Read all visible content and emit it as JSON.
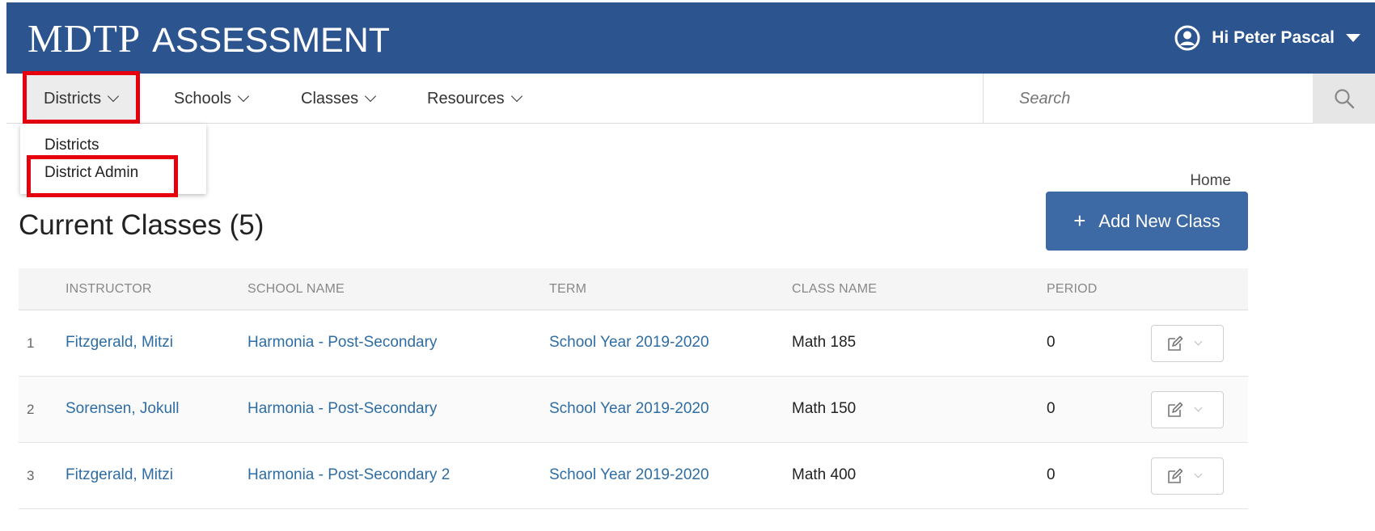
{
  "header": {
    "brand_main": "MDTP",
    "brand_sub": "ASSESSMENT",
    "user_greeting": "Hi Peter Pascal",
    "color": "#2c5590"
  },
  "nav": {
    "items": [
      {
        "label": "Districts"
      },
      {
        "label": "Schools"
      },
      {
        "label": "Classes"
      },
      {
        "label": "Resources"
      }
    ],
    "search_placeholder": "Search"
  },
  "dropdown": {
    "items": [
      {
        "label": "Districts"
      },
      {
        "label": "District Admin"
      }
    ]
  },
  "breadcrumb": "Home",
  "page": {
    "title": "Current Classes (5)",
    "add_button_label": "Add New Class",
    "add_button_icon": "+"
  },
  "table": {
    "columns": [
      "INSTRUCTOR",
      "SCHOOL NAME",
      "TERM",
      "CLASS NAME",
      "PERIOD"
    ],
    "rows": [
      {
        "num": "1",
        "instructor": "Fitzgerald, Mitzi",
        "school": "Harmonia - Post-Secondary",
        "term": "School Year 2019-2020",
        "class_name": "Math 185",
        "period": "0"
      },
      {
        "num": "2",
        "instructor": "Sorensen, Jokull",
        "school": "Harmonia - Post-Secondary",
        "term": "School Year 2019-2020",
        "class_name": "Math 150",
        "period": "0"
      },
      {
        "num": "3",
        "instructor": "Fitzgerald, Mitzi",
        "school": "Harmonia - Post-Secondary 2",
        "term": "School Year 2019-2020",
        "class_name": "Math 400",
        "period": "0"
      }
    ]
  },
  "colors": {
    "accent_button": "#3d6aa4",
    "link": "#2e6da4",
    "highlight": "#e6000e"
  },
  "icons": {
    "user": "user-circle-icon",
    "caret": "caret-down-icon",
    "search": "search-icon",
    "edit": "edit-icon"
  }
}
